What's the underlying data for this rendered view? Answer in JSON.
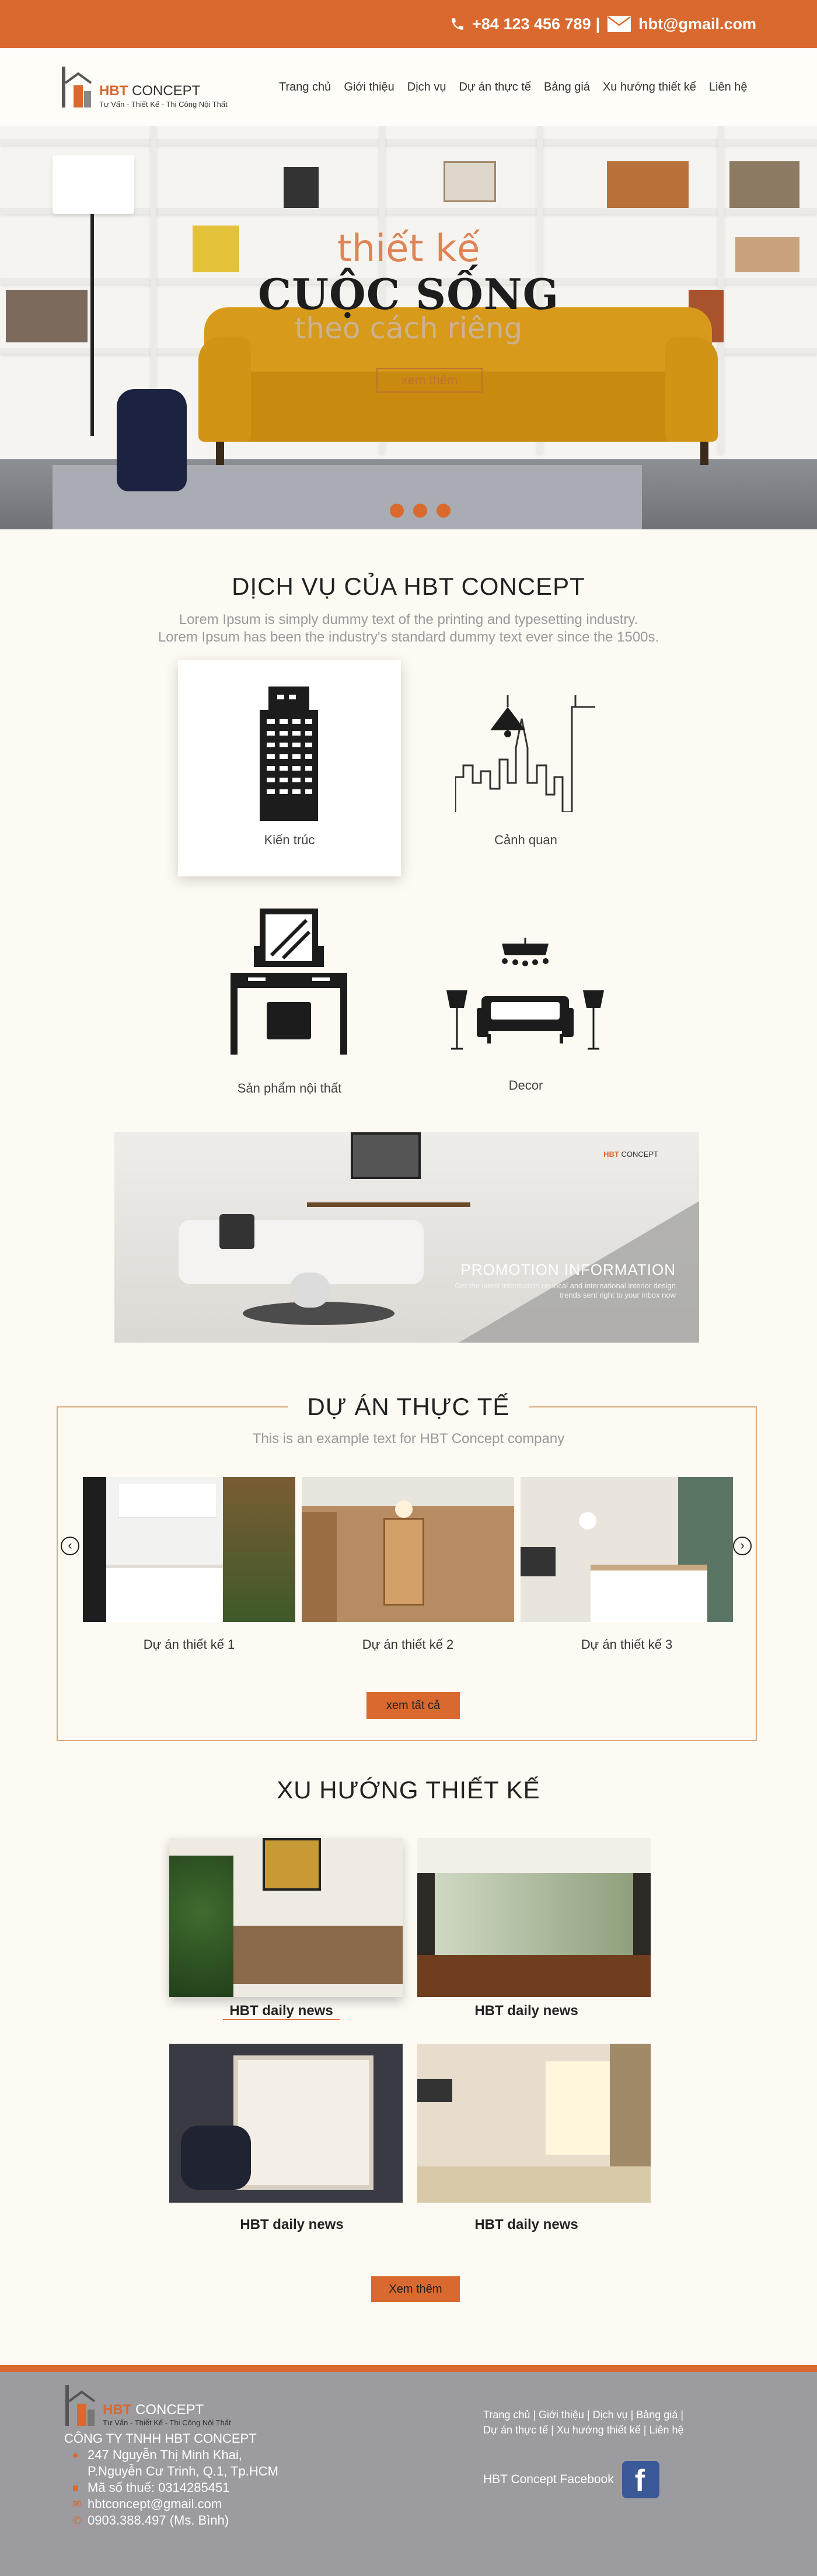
{
  "topbar": {
    "phone_icon": "phone-icon",
    "phone": "+84 123 456 789",
    "separator": "|",
    "mail_icon": "mail-icon",
    "email": "hbt@gmail.com"
  },
  "brand": {
    "name_bold": "HBT",
    "name_rest": "CONCEPT",
    "tagline": "Tư Vấn - Thiết Kế - Thi Công Nội Thất"
  },
  "nav": [
    "Trang chủ",
    "Giới thiệu",
    "Dịch vụ",
    "Dự án thực tế",
    "Bảng giá",
    "Xu hướng thiết kế",
    "Liên hệ"
  ],
  "hero": {
    "line1": "thiết kế",
    "line2": "CUỘC SỐNG",
    "line3": "theo cách riêng",
    "button": "xem thêm",
    "slide_count": 3
  },
  "services": {
    "title": "DỊCH VỤ CỦA HBT CONCEPT",
    "subtitle_1": "Lorem Ipsum is simply dummy text of the printing and typesetting industry.",
    "subtitle_2": "Lorem Ipsum has been the industry's standard dummy text ever since the 1500s.",
    "items": [
      {
        "label": "Kiến trúc",
        "icon": "building-icon"
      },
      {
        "label": "Cảnh quan",
        "icon": "skyline-icon"
      },
      {
        "label": "Sản phẩm nội thất",
        "icon": "dresser-icon"
      },
      {
        "label": "Decor",
        "icon": "sofa-lamp-icon"
      }
    ]
  },
  "promo": {
    "title": "PROMOTION INFORMATION",
    "description": "Get the latest information on local and international interior design trends sent right to your inbox now"
  },
  "projects": {
    "title": "DỰ ÁN THỰC TẾ",
    "subtitle": "This is an example text for HBT Concept company",
    "items": [
      "Dự án thiết kế 1",
      "Dự án thiết kế 2",
      "Dự án thiết kế 3"
    ],
    "prev": "‹",
    "next": "›",
    "button": "xem tất cả"
  },
  "trends": {
    "title": "XU HƯỚNG THIẾT KẾ",
    "items": [
      "HBT daily news",
      "HBT daily news",
      "HBT daily news",
      "HBT daily news"
    ],
    "button": "Xem thêm"
  },
  "footer": {
    "company": "CÔNG TY TNHH HBT CONCEPT",
    "address_1": "247 Nguyễn Thị Minh Khai,",
    "address_2": "P.Nguyễn Cư Trinh, Q.1, Tp.HCM",
    "tax": "Mã số thuế: 0314285451",
    "email": "hbtconcept@gmail.com",
    "phone": "0903.388.497 (Ms. Bình)",
    "links_row1": "Trang chủ | Giới thiệu | Dịch vụ | Bảng giá |",
    "links_row2": "Dự án thực tế | Xu hướng thiết kế | Liên hệ",
    "facebook_label": "HBT Concept Facebook",
    "facebook_icon": "facebook-icon"
  },
  "colors": {
    "accent": "#d9692f",
    "background": "#fdfaf3",
    "footer": "#9c9ca0"
  }
}
